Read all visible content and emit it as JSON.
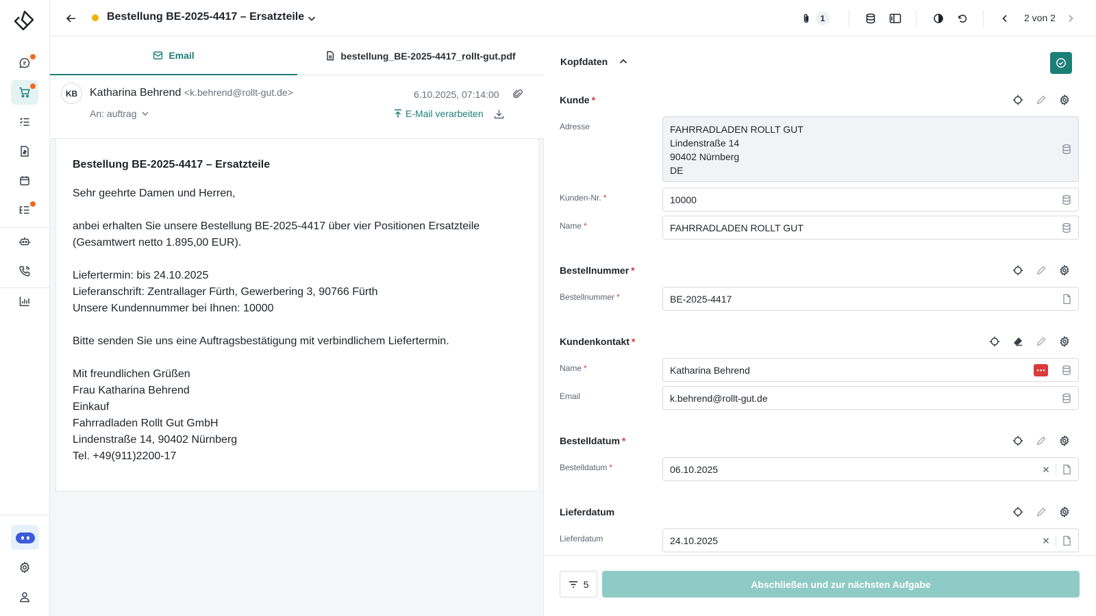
{
  "header": {
    "title": "Bestellung BE-2025-4417 – Ersatzteile",
    "attachments_count": "1",
    "pager": "2 von 2",
    "status_color": "#f0b400"
  },
  "tabs": [
    {
      "label": "Email",
      "icon": "mail-icon"
    },
    {
      "label": "bestellung_BE-2025-4417_rollt-gut.pdf",
      "icon": "document-icon"
    }
  ],
  "email": {
    "initials": "KB",
    "sender_name": "Katharina Behrend",
    "sender_email": "<k.behrend@rollt-gut.de>",
    "date": "6.10.2025, 07:14:00",
    "to": "An: auftrag",
    "process_label": "E-Mail verarbeiten",
    "subject": "Bestellung BE-2025-4417 – Ersatzteile",
    "greeting": "Sehr geehrte Damen und Herren,",
    "para1_l1": "anbei erhalten Sie unsere Bestellung BE-2025-4417 über vier Positionen Ersatzteile",
    "para1_l2": "(Gesamtwert netto 1.895,00 EUR).",
    "l_liefertermin": "Liefertermin: bis 24.10.2025",
    "l_lieferanschrift": "Lieferanschrift: Zentrallager Fürth, Gewerbering 3, 90766 Fürth",
    "l_kundennr": "Unsere Kundennummer bei Ihnen: 10000",
    "request": "Bitte senden Sie uns eine Auftragsbestätigung mit verbindlichem Liefertermin.",
    "sig1": "Mit freundlichen Grüßen",
    "sig2": "Frau Katharina Behrend",
    "sig3": "Einkauf",
    "sig4": "Fahrradladen Rollt Gut GmbH",
    "sig5": "Lindenstraße 14, 90402 Nürnberg",
    "sig6": "Tel. +49(911)2200-17"
  },
  "form": {
    "header_title": "Kopfdaten",
    "kunde": {
      "title": "Kunde",
      "adresse_label": "Adresse",
      "adresse_l1": "FAHRRADLADEN ROLLT GUT",
      "adresse_l2": "Lindenstraße 14",
      "adresse_l3": "90402 Nürnberg",
      "adresse_l4": "DE",
      "kundennr_label": "Kunden-Nr.",
      "kundennr_value": "10000",
      "name_label": "Name",
      "name_value": "FAHRRADLADEN ROLLT GUT"
    },
    "bestellnummer": {
      "title": "Bestellnummer",
      "label": "Bestellnummer",
      "value": "BE-2025-4417"
    },
    "kundenkontakt": {
      "title": "Kundenkontakt",
      "name_label": "Name",
      "name_value": "Katharina Behrend",
      "email_label": "Email",
      "email_value": "k.behrend@rollt-gut.de"
    },
    "bestelldatum": {
      "title": "Bestelldatum",
      "label": "Bestelldatum",
      "value": "06.10.2025"
    },
    "lieferdatum": {
      "title": "Lieferdatum",
      "label": "Lieferdatum",
      "value": "24.10.2025"
    },
    "required_mark": "*"
  },
  "footer": {
    "filter_count": "5",
    "submit_label": "Abschließen und zur nächsten Aufgabe"
  },
  "colors": {
    "accent": "#1b7f78",
    "submit_bg": "#8fcbc6",
    "notification": "#f26b21",
    "required": "#d13b3b"
  }
}
